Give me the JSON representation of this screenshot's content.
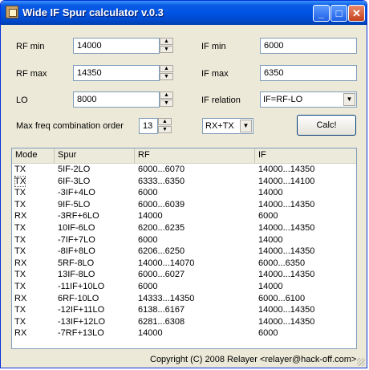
{
  "window": {
    "title": "Wide IF Spur calculator v.0.3",
    "minimize_glyph": "_",
    "maximize_glyph": "□",
    "close_glyph": "✕"
  },
  "form": {
    "rf_min_label": "RF min",
    "rf_min_value": "14000",
    "rf_max_label": "RF max",
    "rf_max_value": "14350",
    "lo_label": "LO",
    "lo_value": "8000",
    "if_min_label": "IF min",
    "if_min_value": "6000",
    "if_max_label": "IF max",
    "if_max_value": "6350",
    "if_relation_label": "IF relation",
    "if_relation_value": "IF=RF-LO",
    "max_order_label": "Max freq combination order",
    "max_order_value": "13",
    "mode_value": "RX+TX",
    "calc_label": "Calc!"
  },
  "table": {
    "columns": [
      "Mode",
      "Spur",
      "RF",
      "IF"
    ],
    "rows": [
      [
        "TX",
        "5IF-2LO",
        "6000...6070",
        "14000...14350"
      ],
      [
        "TX",
        "6IF-3LO",
        "6333...6350",
        "14000...14100"
      ],
      [
        "TX",
        "-3IF+4LO",
        "6000",
        "14000"
      ],
      [
        "TX",
        "9IF-5LO",
        "6000...6039",
        "14000...14350"
      ],
      [
        "RX",
        "-3RF+6LO",
        "14000",
        "6000"
      ],
      [
        "TX",
        "10IF-6LO",
        "6200...6235",
        "14000...14350"
      ],
      [
        "TX",
        "-7IF+7LO",
        "6000",
        "14000"
      ],
      [
        "TX",
        "-8IF+8LO",
        "6206...6250",
        "14000...14350"
      ],
      [
        "RX",
        "5RF-8LO",
        "14000...14070",
        "6000...6350"
      ],
      [
        "TX",
        "13IF-8LO",
        "6000...6027",
        "14000...14350"
      ],
      [
        "TX",
        "-11IF+10LO",
        "6000",
        "14000"
      ],
      [
        "RX",
        "6RF-10LO",
        "14333...14350",
        "6000...6100"
      ],
      [
        "TX",
        "-12IF+11LO",
        "6138...6167",
        "14000...14350"
      ],
      [
        "TX",
        "-13IF+12LO",
        "6281...6308",
        "14000...14350"
      ],
      [
        "RX",
        "-7RF+13LO",
        "14000",
        "6000"
      ]
    ]
  },
  "status": {
    "copyright": "Copyright (C) 2008 Relayer <relayer@hack-off.com>"
  }
}
